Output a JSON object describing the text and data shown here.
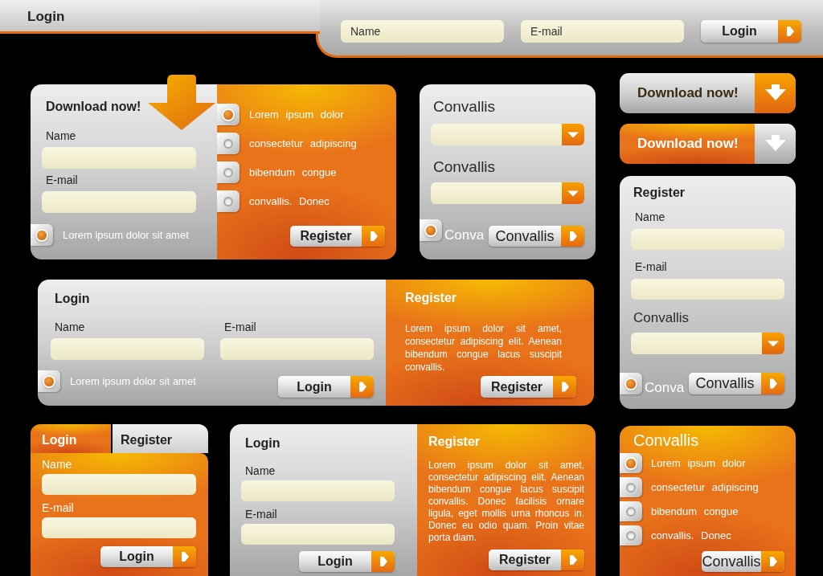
{
  "top_bar": {
    "title": "Login",
    "name_field": {
      "placeholder": "Name"
    },
    "email_field": {
      "placeholder": "E-mail"
    },
    "login_button": "Login"
  },
  "download_panel": {
    "title": "Download now!",
    "fields": [
      {
        "label": "Name"
      },
      {
        "label": "E-mail"
      }
    ],
    "remember": {
      "label": "Lorem ipsum dolor sit amet",
      "selected": true
    },
    "options": [
      {
        "label": "Lorem ipsum dolor",
        "selected": true
      },
      {
        "label": "consectetur adipiscing",
        "selected": false
      },
      {
        "label": "bibendum congue",
        "selected": false
      },
      {
        "label": "convallis. Donec",
        "selected": false
      }
    ],
    "register_button": "Register"
  },
  "select_panel": {
    "selects": [
      {
        "label": "Convallis"
      },
      {
        "label": "Convallis"
      }
    ],
    "option": {
      "label": "Conva",
      "selected": true
    },
    "button": "Convallis"
  },
  "download_buttons": [
    {
      "label": "Download now!",
      "kind": "neutral"
    },
    {
      "label": "Download now!",
      "kind": "accent"
    }
  ],
  "register_card": {
    "title": "Register",
    "fields": [
      {
        "label": "Name"
      },
      {
        "label": "E-mail"
      }
    ],
    "select": {
      "label": "Convallis"
    },
    "option": {
      "label": "Conva",
      "selected": true
    },
    "button": "Convallis"
  },
  "login_register_wide": {
    "login": {
      "title": "Login",
      "fields": [
        {
          "label": "Name"
        },
        {
          "label": "E-mail"
        }
      ],
      "remember": {
        "label": "Lorem ipsum dolor sit amet",
        "selected": true
      },
      "button": "Login"
    },
    "register": {
      "title": "Register",
      "text": "Lorem ipsum dolor sit amet, consectetur adipiscing elit. Aenean bibendum congue lacus suscipit convallis.",
      "button": "Register"
    }
  },
  "tabbed_login": {
    "tabs": [
      {
        "label": "Login",
        "selected": true
      },
      {
        "label": "Register",
        "selected": false
      }
    ],
    "fields": [
      {
        "label": "Name"
      },
      {
        "label": "E-mail"
      }
    ],
    "button": "Login"
  },
  "login_register_tall": {
    "login": {
      "title": "Login",
      "fields": [
        {
          "label": "Name"
        },
        {
          "label": "E-mail"
        }
      ],
      "button": "Login"
    },
    "register": {
      "title": "Register",
      "text": "Lorem ipsum dolor sit amet, consectetur adipiscing elit. Aenean bibendum congue lacus suscipit convallis. Donec facilisis ornare ligula, eget mollis urna rhoncus in. Donec eu odio quam. Proin vitae porta diam.",
      "button": "Register"
    }
  },
  "options_card": {
    "title": "Convallis",
    "options": [
      {
        "label": "Lorem ipsum dolor",
        "selected": true
      },
      {
        "label": "consectetur adipiscing",
        "selected": false
      },
      {
        "label": "bibendum congue",
        "selected": false
      },
      {
        "label": "convallis. Donec",
        "selected": false
      }
    ],
    "button": "Convallis"
  }
}
